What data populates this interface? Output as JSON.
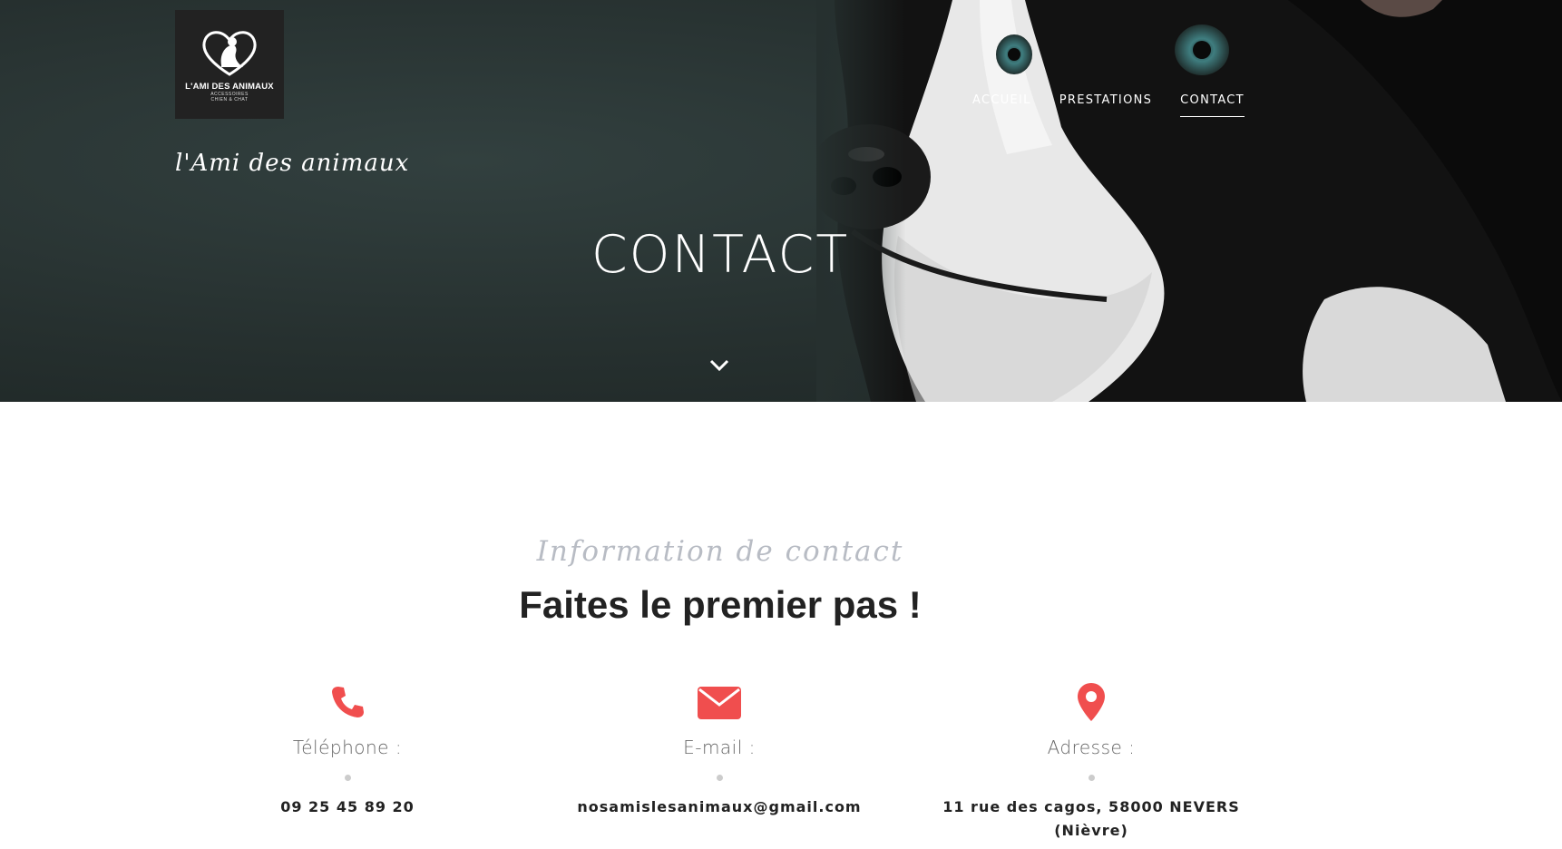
{
  "header": {
    "logo": {
      "brand": "L'AMI DES ANIMAUX",
      "tagline": "ACCESSOIRES",
      "tagline2": "CHIEN & CHAT"
    },
    "site_name": "l'Ami des animaux",
    "nav": [
      {
        "label": "ACCUEIL",
        "active": false
      },
      {
        "label": "PRESTATIONS",
        "active": false
      },
      {
        "label": "CONTACT",
        "active": true
      }
    ]
  },
  "hero": {
    "title": "CONTACT",
    "scroll_icon": "chevron-down-icon"
  },
  "contact": {
    "subtitle": "Information de contact",
    "headline": "Faites le premier pas !",
    "accent_color": "#f04e4e",
    "items": [
      {
        "icon": "phone-icon",
        "label": "Téléphone :",
        "value": "09 25 45 89 20"
      },
      {
        "icon": "envelope-icon",
        "label": "E-mail :",
        "value": "nosamislesanimaux@gmail.com"
      },
      {
        "icon": "map-pin-icon",
        "label": "Adresse :",
        "value": "11 rue des cagos, 58000 NEVERS",
        "value2": "(Nièvre)"
      }
    ]
  }
}
